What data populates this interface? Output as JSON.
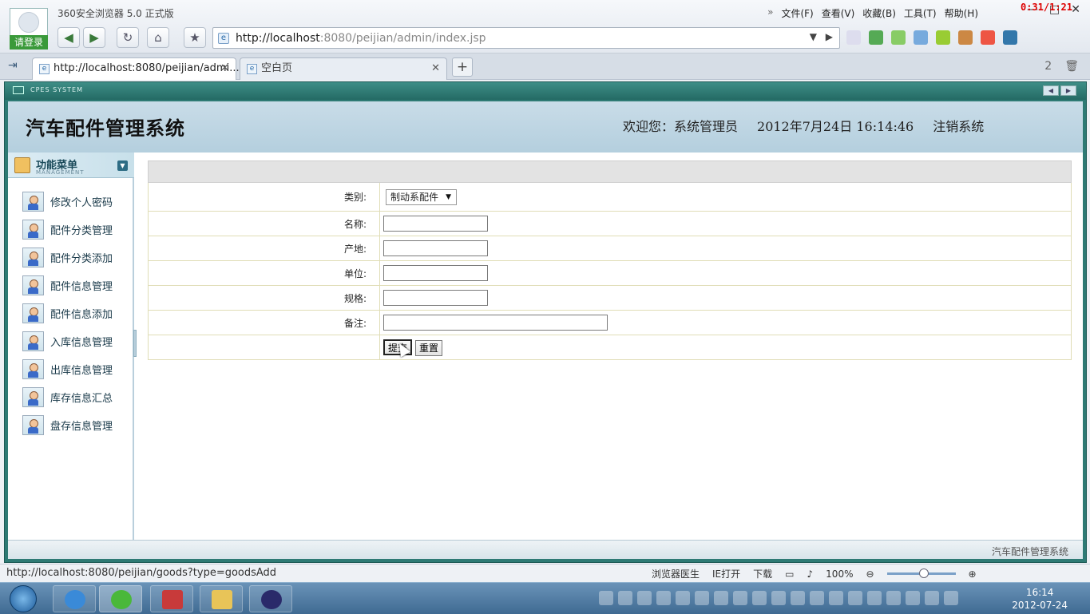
{
  "browser": {
    "title": "360安全浏览器 5.0 正式版",
    "login_label": "请登录",
    "menu": [
      "文件(F)",
      "查看(V)",
      "收藏(B)",
      "工具(T)",
      "帮助(H)"
    ],
    "menu_chevron": "»",
    "timer": "0:31/1:21",
    "url_host": "http://localhost",
    "url_rest": ":8080/peijian/admin/index.jsp",
    "tabs": [
      {
        "label": "http://localhost:8080/peijian/admi..."
      },
      {
        "label": "空白页"
      }
    ],
    "status_url": "http://localhost:8080/peijian/goods?type=goodsAdd",
    "status_items": [
      "浏览器医生",
      "IE打开",
      "下载"
    ],
    "zoom": "100%",
    "tab_count": "2"
  },
  "app": {
    "system_label": "CPES SYSTEM",
    "title": "汽车配件管理系统",
    "welcome": "欢迎您：系统管理员",
    "datetime": "2012年7月24日  16:14:46",
    "logout": "注销系统",
    "footer": "汽车配件管理系统",
    "menu_title": "功能菜单",
    "menu_subtitle": "MANAGEMENT",
    "menu_items": [
      {
        "label": "修改个人密码"
      },
      {
        "label": "配件分类管理"
      },
      {
        "label": "配件分类添加"
      },
      {
        "label": "配件信息管理"
      },
      {
        "label": "配件信息添加"
      },
      {
        "label": "入库信息管理"
      },
      {
        "label": "出库信息管理"
      },
      {
        "label": "库存信息汇总"
      },
      {
        "label": "盘存信息管理"
      }
    ]
  },
  "form": {
    "category_label": "类别:",
    "category_value": "制动系配件",
    "name_label": "名称:",
    "origin_label": "产地:",
    "unit_label": "单位:",
    "spec_label": "规格:",
    "remark_label": "备注:",
    "submit_label": "提交",
    "reset_label": "重置"
  },
  "taskbar": {
    "time": "16:14",
    "date": "2012-07-24"
  },
  "colors": {
    "frame_teal": "#2e7a74",
    "header_blue": "#c9dce8",
    "form_border": "#e0ddb6"
  }
}
